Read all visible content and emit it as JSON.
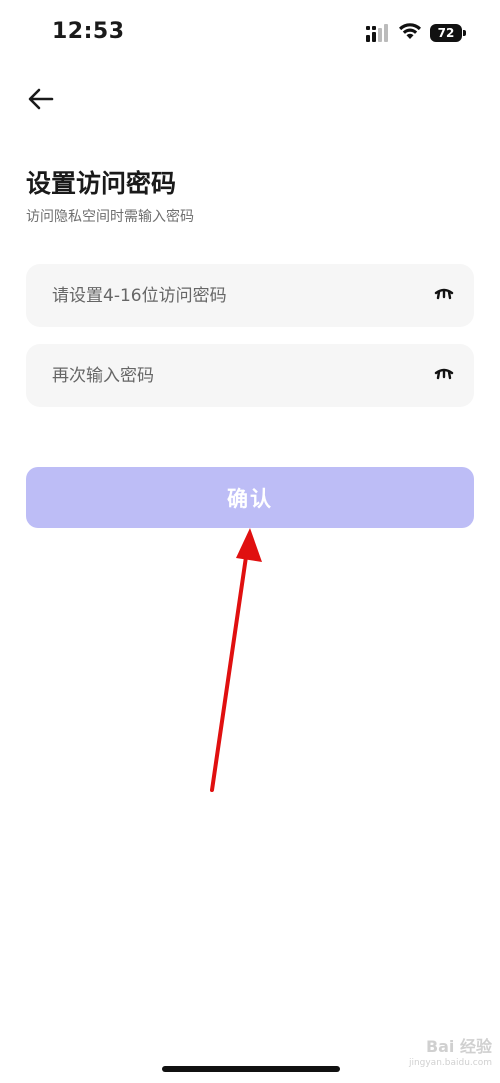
{
  "status_bar": {
    "time": "12:53",
    "battery_level": "72",
    "icons": [
      "signal-icon",
      "wifi-icon",
      "battery-icon"
    ]
  },
  "header": {
    "back_icon": "arrow-left-icon"
  },
  "page": {
    "title": "设置访问密码",
    "subtitle": "访问隐私空间时需输入密码"
  },
  "form": {
    "password": {
      "placeholder": "请设置4-16位访问密码",
      "value": "",
      "toggle_icon": "eye-closed-icon"
    },
    "confirm_password": {
      "placeholder": "再次输入密码",
      "value": "",
      "toggle_icon": "eye-closed-icon"
    },
    "submit_label": "确认"
  },
  "annotation": {
    "color": "#e01010"
  },
  "watermark": {
    "text": "Bai 经验",
    "sub": "jingyan.baidu.com"
  },
  "colors": {
    "button_bg": "#bdbdf6",
    "field_bg": "#f6f6f6",
    "title_text": "#1a1a1a",
    "subtitle_text": "#6f6f6f"
  }
}
